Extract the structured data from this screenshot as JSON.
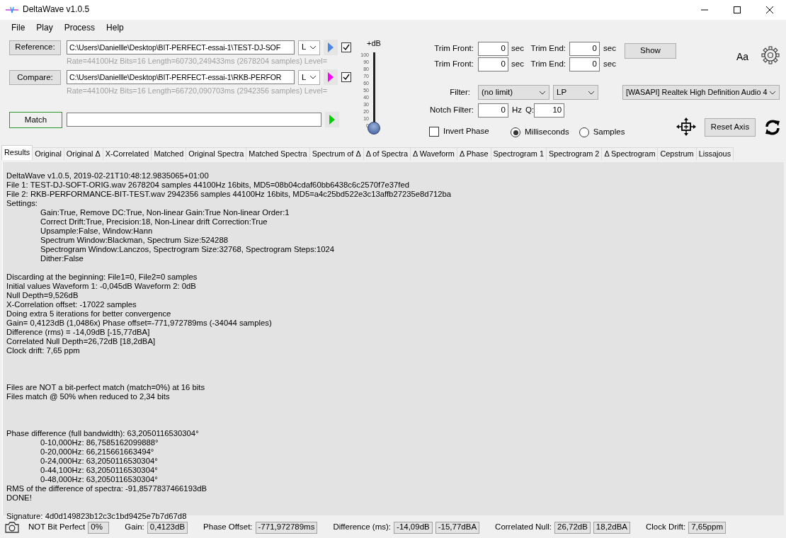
{
  "window": {
    "title": "DeltaWave v1.0.5"
  },
  "menu": [
    "File",
    "Play",
    "Process",
    "Help"
  ],
  "files": [
    {
      "button": "Reference:",
      "path": "C:\\Users\\Daniellle\\Desktop\\BIT-PERFECT-essai-1\\TEST-DJ-SOF",
      "channel": "L",
      "info": "Rate=44100Hz Bits=16 Length=60730,249433ms (2678204 samples) Level=",
      "play": {
        "color": "#4a86e8"
      },
      "checked": true
    },
    {
      "button": "Compare:",
      "path": "C:\\Users\\Daniellle\\Desktop\\BIT-PERFECT-essai-1\\RKB-PERFOR",
      "channel": "L",
      "info": "Rate=44100Hz Bits=16 Length=66720,090703ms (2942356 samples) Level=",
      "play": {
        "color": "#ff00ff"
      },
      "checked": true
    }
  ],
  "match": {
    "button": "Match",
    "play": {
      "color": "#00d000"
    }
  },
  "volume": {
    "label": "+dB",
    "ticks": [
      "100",
      "90",
      "80",
      "70",
      "60",
      "50",
      "40",
      "30",
      "20",
      "10",
      "0"
    ],
    "level": 0
  },
  "trim": [
    {
      "front_label": "Trim Front:",
      "front_value": "0",
      "front_unit": "sec",
      "end_label": "Trim End:",
      "end_value": "0",
      "end_unit": "sec"
    },
    {
      "front_label": "Trim Front:",
      "front_value": "0",
      "front_unit": "sec",
      "end_label": "Trim End:",
      "end_value": "0",
      "end_unit": "sec"
    }
  ],
  "show_button": "Show",
  "font_button": "Aa",
  "filter": {
    "label": "Filter:",
    "value": "(no limit)",
    "type": "LP"
  },
  "device": "[WASAPI] Realtek High Definition Audio 4",
  "notch": {
    "label": "Notch Filter:",
    "value": "0",
    "unit": "Hz",
    "q_label": "Q:",
    "q_value": "10"
  },
  "invert_phase": {
    "label": "Invert Phase",
    "checked": false
  },
  "units": [
    {
      "label": "Milliseconds",
      "selected": true
    },
    {
      "label": "Samples",
      "selected": false
    }
  ],
  "reset_axis": "Reset Axis",
  "tabs": [
    {
      "label": "Results",
      "selected": true
    },
    {
      "label": "Original",
      "selected": false
    },
    {
      "label": "Original Δ",
      "selected": false
    },
    {
      "label": "X-Correlated",
      "selected": false
    },
    {
      "label": "Matched",
      "selected": false
    },
    {
      "label": "Original Spectra",
      "selected": false
    },
    {
      "label": "Matched Spectra",
      "selected": false
    },
    {
      "label": "Spectrum of Δ",
      "selected": false
    },
    {
      "label": "Δ of Spectra",
      "selected": false
    },
    {
      "label": "Δ Waveform",
      "selected": false
    },
    {
      "label": "Δ Phase",
      "selected": false
    },
    {
      "label": "Spectrogram 1",
      "selected": false
    },
    {
      "label": "Spectrogram 2",
      "selected": false
    },
    {
      "label": "Δ Spectrogram",
      "selected": false
    },
    {
      "label": "Cepstrum",
      "selected": false
    },
    {
      "label": "Lissajous",
      "selected": false
    }
  ],
  "results": [
    {
      "kind": "line",
      "text": "DeltaWave v1.0.5, 2019-02-21T10:48:12.9835065+01:00",
      "indent": false
    },
    {
      "kind": "line",
      "text": "File 1:  TEST-DJ-SOFT-ORIG.wav 2678204 samples 44100Hz 16bits, MD5=08b04cdaf60bb6438c6c2570f7e37fed",
      "indent": false
    },
    {
      "kind": "line",
      "text": "File 2: RKB-PERFORMANCE-BIT-TEST.wav 2942356 samples 44100Hz 16bits, MD5=a4c25bd522e3c13affb27235e8d712ba",
      "indent": false
    },
    {
      "kind": "line",
      "text": "Settings:",
      "indent": false
    },
    {
      "kind": "line",
      "text": "Gain:True, Remove DC:True, Non-linear Gain:True Non-linear Order:1",
      "indent": true
    },
    {
      "kind": "line",
      "text": "Correct Drift:True, Precision:18, Non-Linear drift Correction:True",
      "indent": true
    },
    {
      "kind": "line",
      "text": "Upsample:False, Window:Hann",
      "indent": true
    },
    {
      "kind": "line",
      "text": "Spectrum Window:Blackman, Spectrum Size:524288",
      "indent": true
    },
    {
      "kind": "line",
      "text": "Spectrogram Window:Lanczos, Spectrogram Size:32768, Spectrogram Steps:1024",
      "indent": true
    },
    {
      "kind": "line",
      "text": "Dither:False",
      "indent": true
    },
    {
      "kind": "blank"
    },
    {
      "kind": "line",
      "text": "Discarding at the beginning: File1=0, File2=0 samples",
      "indent": false
    },
    {
      "kind": "line",
      "text": "Initial values Waveform 1: -0,045dB   Waveform 2: 0dB",
      "indent": false
    },
    {
      "kind": "line",
      "text": "Null Depth=9,526dB",
      "indent": false
    },
    {
      "kind": "line",
      "text": "X-Correlation offset: -17022 samples",
      "indent": false
    },
    {
      "kind": "line",
      "text": "Doing extra 5 iterations for better convergence",
      "indent": false
    },
    {
      "kind": "line",
      "text": "Gain= 0,4123dB (1,0486x) Phase offset=-771,972789ms (-34044 samples)",
      "indent": false
    },
    {
      "kind": "line",
      "text": "Difference (rms) = -14,09dB [-15,77dBA]",
      "indent": false
    },
    {
      "kind": "line",
      "text": "Correlated Null Depth=26,72dB [18,2dBA]",
      "indent": false
    },
    {
      "kind": "line",
      "text": "Clock drift: 7,65 ppm",
      "indent": false
    },
    {
      "kind": "blank"
    },
    {
      "kind": "blank"
    },
    {
      "kind": "blank"
    },
    {
      "kind": "line",
      "text": "Files are NOT a bit-perfect match (match=0%) at 16 bits",
      "indent": false
    },
    {
      "kind": "line",
      "text": "Files match @ 50% when reduced to 2,34 bits",
      "indent": false
    },
    {
      "kind": "blank"
    },
    {
      "kind": "blank"
    },
    {
      "kind": "blank"
    },
    {
      "kind": "line",
      "text": "Phase difference (full bandwidth): 63,2050116530304°",
      "indent": false
    },
    {
      "kind": "line",
      "text": "0-10,000Hz: 86,7585162099888°",
      "indent": true
    },
    {
      "kind": "line",
      "text": "0-20,000Hz: 66,215661663494°",
      "indent": true
    },
    {
      "kind": "line",
      "text": "0-24,000Hz: 63,2050116530304°",
      "indent": true
    },
    {
      "kind": "line",
      "text": "0-44,100Hz: 63,2050116530304°",
      "indent": true
    },
    {
      "kind": "line",
      "text": "0-48,000Hz: 63,2050116530304°",
      "indent": true
    },
    {
      "kind": "line",
      "text": "RMS of the difference of spectra: -91,8577837466193dB",
      "indent": false
    },
    {
      "kind": "line",
      "text": "DONE!",
      "indent": false
    },
    {
      "kind": "blank"
    },
    {
      "kind": "line",
      "text": "Signature: 4d0d149823b12c3c1bd9425e7b7d67d8",
      "indent": false
    }
  ],
  "status": [
    {
      "label": "NOT Bit Perfect",
      "values": [
        "0%"
      ]
    },
    {
      "label": "Gain:",
      "values": [
        "0,4123dB"
      ]
    },
    {
      "label": "Phase Offset:",
      "values": [
        "-771,972789ms"
      ]
    },
    {
      "label": "Difference (ms):",
      "values": [
        "-14,09dB",
        "-15,77dBA"
      ]
    },
    {
      "label": "Correlated Null:",
      "values": [
        "26,72dB",
        "18,2dBA"
      ]
    },
    {
      "label": "Clock Drift:",
      "values": [
        "7,65ppm"
      ]
    }
  ]
}
